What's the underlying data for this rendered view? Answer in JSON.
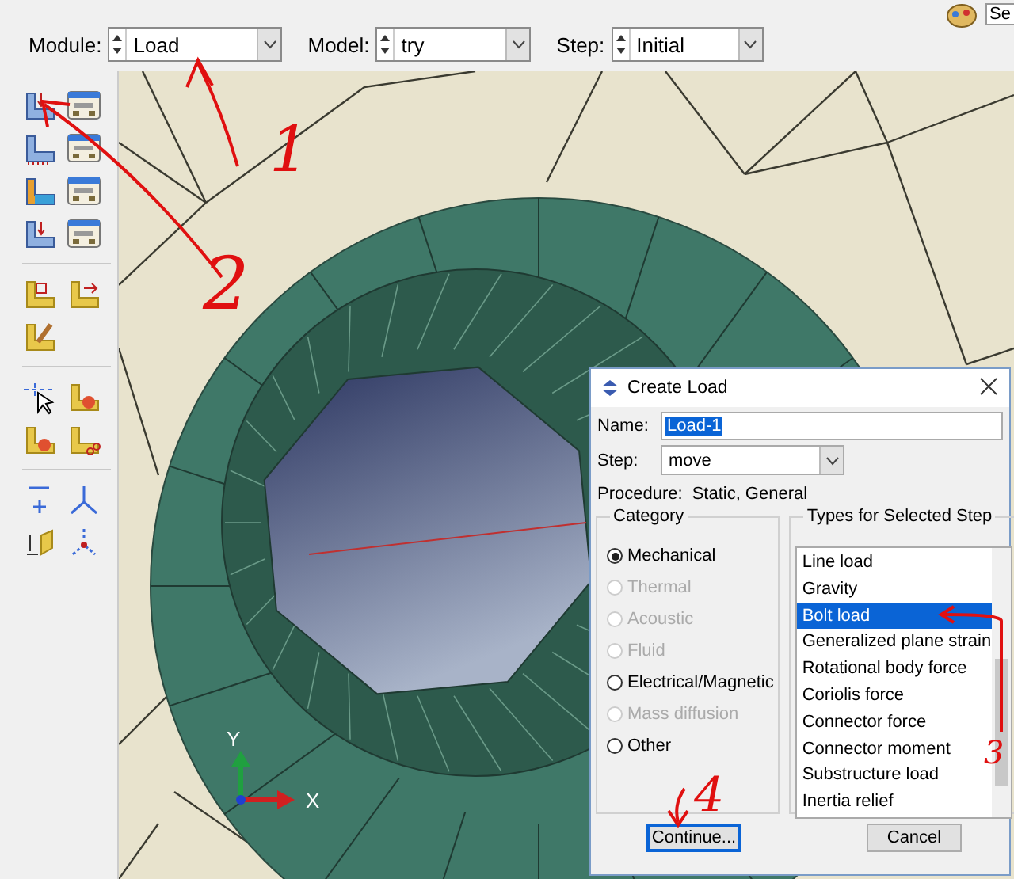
{
  "top_bar": {
    "right_field": "Se",
    "selectors": [
      {
        "label": "Module:",
        "value": "Load"
      },
      {
        "label": "Model:",
        "value": "try"
      },
      {
        "label": "Step:",
        "value": "Initial"
      }
    ]
  },
  "viewport": {
    "triad": {
      "y_label": "Y",
      "x_label": "X"
    }
  },
  "dialog": {
    "title": "Create Load",
    "name_label": "Name:",
    "name_value": "Load-1",
    "name_highlighted": true,
    "step_label": "Step:",
    "step_value": "move",
    "procedure_label": "Procedure:",
    "procedure_value": "Static, General",
    "category": {
      "title": "Category",
      "options": [
        {
          "label": "Mechanical",
          "selected": true,
          "disabled": false
        },
        {
          "label": "Thermal",
          "selected": false,
          "disabled": true
        },
        {
          "label": "Acoustic",
          "selected": false,
          "disabled": true
        },
        {
          "label": "Fluid",
          "selected": false,
          "disabled": true
        },
        {
          "label": "Electrical/Magnetic",
          "selected": false,
          "disabled": false
        },
        {
          "label": "Mass diffusion",
          "selected": false,
          "disabled": true
        },
        {
          "label": "Other",
          "selected": false,
          "disabled": false
        }
      ]
    },
    "types": {
      "title": "Types for Selected Step",
      "items": [
        {
          "label": "Line load",
          "selected": false
        },
        {
          "label": "Gravity",
          "selected": false
        },
        {
          "label": "Bolt load",
          "selected": true
        },
        {
          "label": "Generalized plane strain",
          "selected": false
        },
        {
          "label": "Rotational body force",
          "selected": false
        },
        {
          "label": "Coriolis force",
          "selected": false
        },
        {
          "label": "Connector force",
          "selected": false
        },
        {
          "label": "Connector moment",
          "selected": false
        },
        {
          "label": "Substructure load",
          "selected": false
        },
        {
          "label": "Inertia relief",
          "selected": false
        }
      ]
    },
    "buttons": [
      {
        "label": "Continue...",
        "focused": true
      },
      {
        "label": "Cancel",
        "focused": false
      }
    ]
  },
  "annotations": [
    {
      "text": "1"
    },
    {
      "text": "2"
    },
    {
      "text": "3"
    },
    {
      "text": "4"
    }
  ]
}
